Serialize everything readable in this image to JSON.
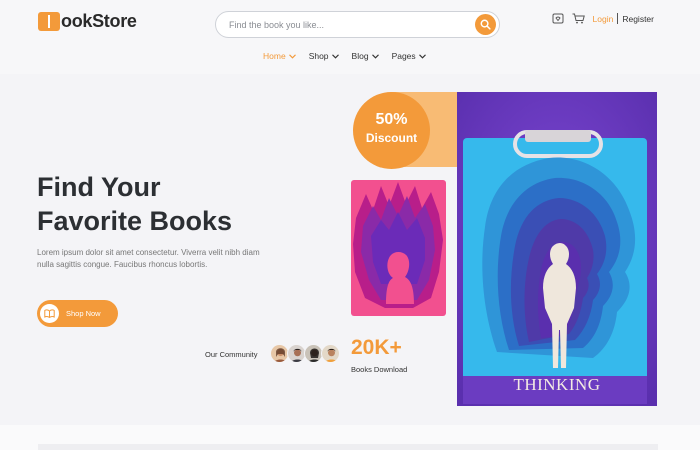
{
  "brand": {
    "logo_text": "ookStore",
    "logo_icon": "book-logo-icon",
    "accent_color": "#f39a3a"
  },
  "search": {
    "value": "",
    "placeholder": "Find the book you like...",
    "icon": "search-icon"
  },
  "account": {
    "wishlist_icon": "wishlist-icon",
    "cart_icon": "cart-icon",
    "login_label": "Login",
    "register_label": "Register"
  },
  "nav": {
    "items": [
      {
        "label": "Home",
        "active": true
      },
      {
        "label": "Shop",
        "active": false
      },
      {
        "label": "Blog",
        "active": false
      },
      {
        "label": "Pages",
        "active": false
      }
    ]
  },
  "hero": {
    "title_line1": "Find Your",
    "title_line2": "Favorite Books",
    "description": "Lorem ipsum dolor sit amet consectetur. Viverra velit nibh diam nulla sagittis congue. Faucibus rhoncus lobortis.",
    "cta_label": "Shop Now",
    "community_label": "Our Community",
    "stat_value": "20K+",
    "stat_label": "Books Download",
    "discount_value": "50%",
    "discount_label": "Discount",
    "featured_book_title": "THINKING"
  }
}
